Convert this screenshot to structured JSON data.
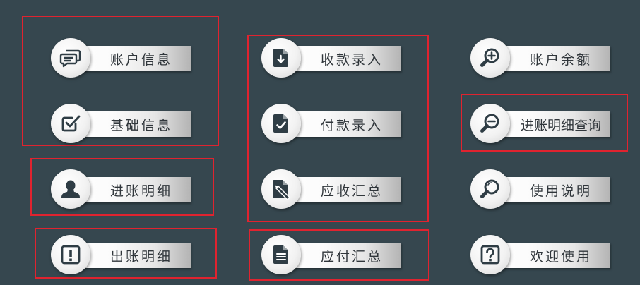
{
  "buttons": [
    {
      "label": "账户信息",
      "icon": "chat-icon"
    },
    {
      "label": "基础信息",
      "icon": "checkbox-icon"
    },
    {
      "label": "进账明细",
      "icon": "user-icon"
    },
    {
      "label": "出账明细",
      "icon": "alert-icon"
    },
    {
      "label": "收款录入",
      "icon": "download-doc-icon"
    },
    {
      "label": "付款录入",
      "icon": "check-doc-icon"
    },
    {
      "label": "应收汇总",
      "icon": "edit-doc-icon"
    },
    {
      "label": "应付汇总",
      "icon": "text-doc-icon"
    },
    {
      "label": "账户余额",
      "icon": "zoom-in-icon"
    },
    {
      "label": "进账明细查询",
      "icon": "zoom-out-icon"
    },
    {
      "label": "使用说明",
      "icon": "search-icon"
    },
    {
      "label": "欢迎使用",
      "icon": "help-icon"
    }
  ],
  "colors": {
    "background": "#36474f",
    "highlight": "#e0232f",
    "icon": "#2f3d45",
    "text": "#30363b"
  }
}
